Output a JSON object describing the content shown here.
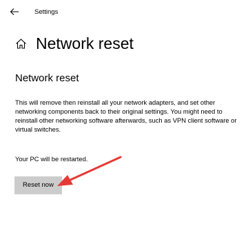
{
  "window": {
    "title": "Settings"
  },
  "page": {
    "title": "Network reset",
    "home_icon": "home-icon",
    "back_icon": "arrow-left-icon"
  },
  "section": {
    "title": "Network reset",
    "description": "This will remove then reinstall all your network adapters, and set other networking components back to their original settings. You might need to reinstall other networking software afterwards, such as VPN client software or virtual switches.",
    "restart_note": "Your PC will be restarted.",
    "reset_button_label": "Reset now"
  },
  "colors": {
    "button_background": "#cccccc",
    "annotation_arrow": "#e53935"
  }
}
